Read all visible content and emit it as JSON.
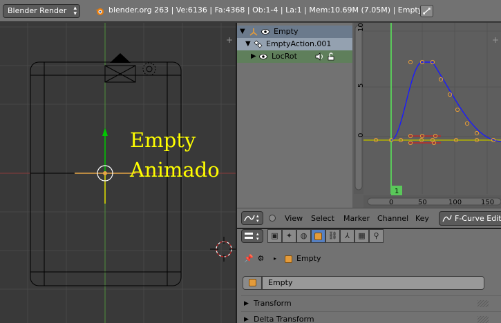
{
  "topbar": {
    "render_engine": "Blender Render",
    "stats": "blender.org 263 | Ve:6136 | Fa:4368 | Ob:1-4 | La:1 | Mem:10.69M (7.05M) | Empty"
  },
  "viewport": {
    "overlay_line1": "Empty",
    "overlay_line2": "Animado"
  },
  "channels": [
    {
      "label": "Empty",
      "icon": "empty-axes-icon"
    },
    {
      "label": "EmptyAction.001",
      "icon": "action-icon"
    },
    {
      "label": "LocRot",
      "icon": "fcurve-group-icon"
    }
  ],
  "graph": {
    "current_frame": "1",
    "y_ticks": [
      "10",
      "5",
      "0"
    ],
    "x_ticks": [
      "0",
      "50",
      "100",
      "150"
    ]
  },
  "graph_header": {
    "menus": [
      "View",
      "Select",
      "Marker",
      "Channel",
      "Key"
    ],
    "mode": "F-Curve Editor"
  },
  "properties": {
    "breadcrumb_object": "Empty",
    "object_name": "Empty",
    "panels": [
      "Transform",
      "Delta Transform"
    ]
  },
  "colors": {
    "accent_blue": "#5680c2",
    "curve_blue": "#0000ff",
    "keyframe_orange": "#e49b3a",
    "text_yellow": "#ffff00"
  }
}
